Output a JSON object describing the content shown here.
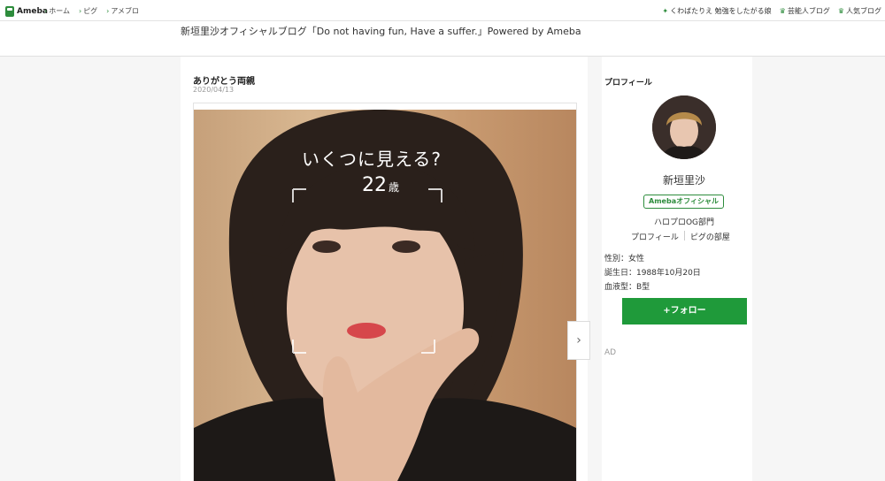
{
  "topbar": {
    "logo": "Ameba",
    "nav": [
      "ホーム",
      "ピグ",
      "アメブロ"
    ],
    "right_links": [
      {
        "icon": "sparkle-icon",
        "label": "くわばたりえ 勉強をしたがる娘"
      },
      {
        "icon": "crown-icon",
        "label": "芸能人ブログ"
      },
      {
        "icon": "crown-icon",
        "label": "人気ブログ"
      }
    ]
  },
  "blog": {
    "title": "新垣里沙オフィシャルブログ「Do not having fun, Have a suffer.」Powered by Ameba"
  },
  "article": {
    "title": "ありがとう両親",
    "date": "2020/04/13",
    "photo_text_question": "いくつに見える?",
    "photo_text_age": "22",
    "photo_text_unit": "歳",
    "next_glyph": "›"
  },
  "profile": {
    "heading": "プロフィール",
    "name": "新垣里沙",
    "badge": "Amebaオフィシャル",
    "department": "ハロプロOG部門",
    "link_profile": "プロフィール",
    "link_pig": "ピグの部屋",
    "gender": "性別：女性",
    "birthday": "誕生日：1988年10月20日",
    "blood": "血液型：B型",
    "follow": "+フォロー",
    "ad": "AD"
  },
  "colors": {
    "brand_green": "#2d8c3c",
    "follow_green": "#1f9a3a"
  }
}
